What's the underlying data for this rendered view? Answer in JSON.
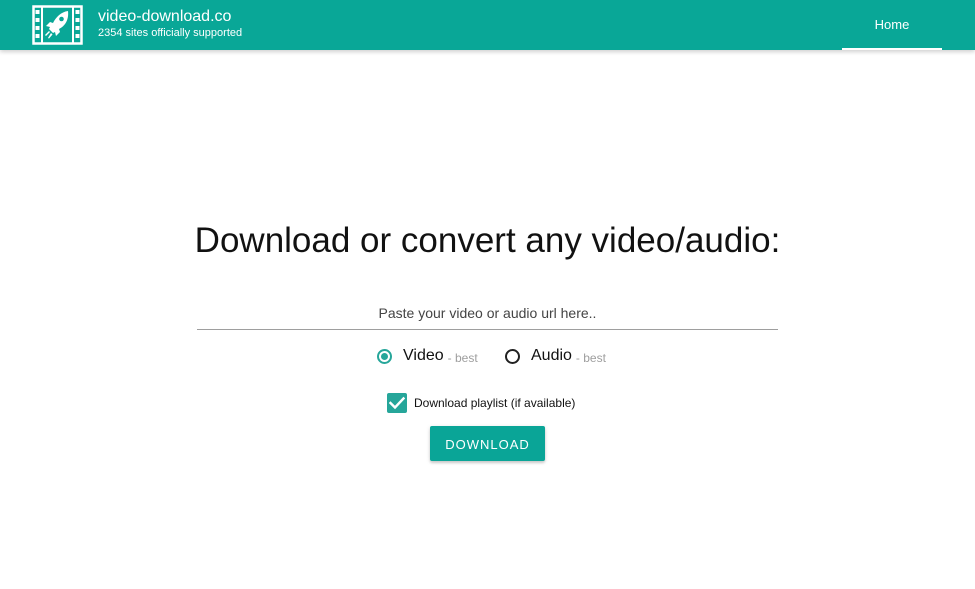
{
  "header": {
    "site_name": "video-download.co",
    "tagline": "2354 sites officially supported",
    "nav_home": "Home",
    "logo_icon": "film-rocket-icon",
    "bg_color": "#09a797"
  },
  "main": {
    "headline": "Download or convert any video/audio:",
    "url_input": {
      "placeholder": "Paste your video or audio url here..",
      "value": ""
    },
    "format_options": [
      {
        "label": "Video",
        "hint": "- best",
        "selected": true
      },
      {
        "label": "Audio",
        "hint": "- best",
        "selected": false
      }
    ],
    "playlist_checkbox": {
      "label": "Download playlist (if available)",
      "checked": true
    },
    "download_button": "DOWNLOAD",
    "accent_color": "#26a69a"
  }
}
